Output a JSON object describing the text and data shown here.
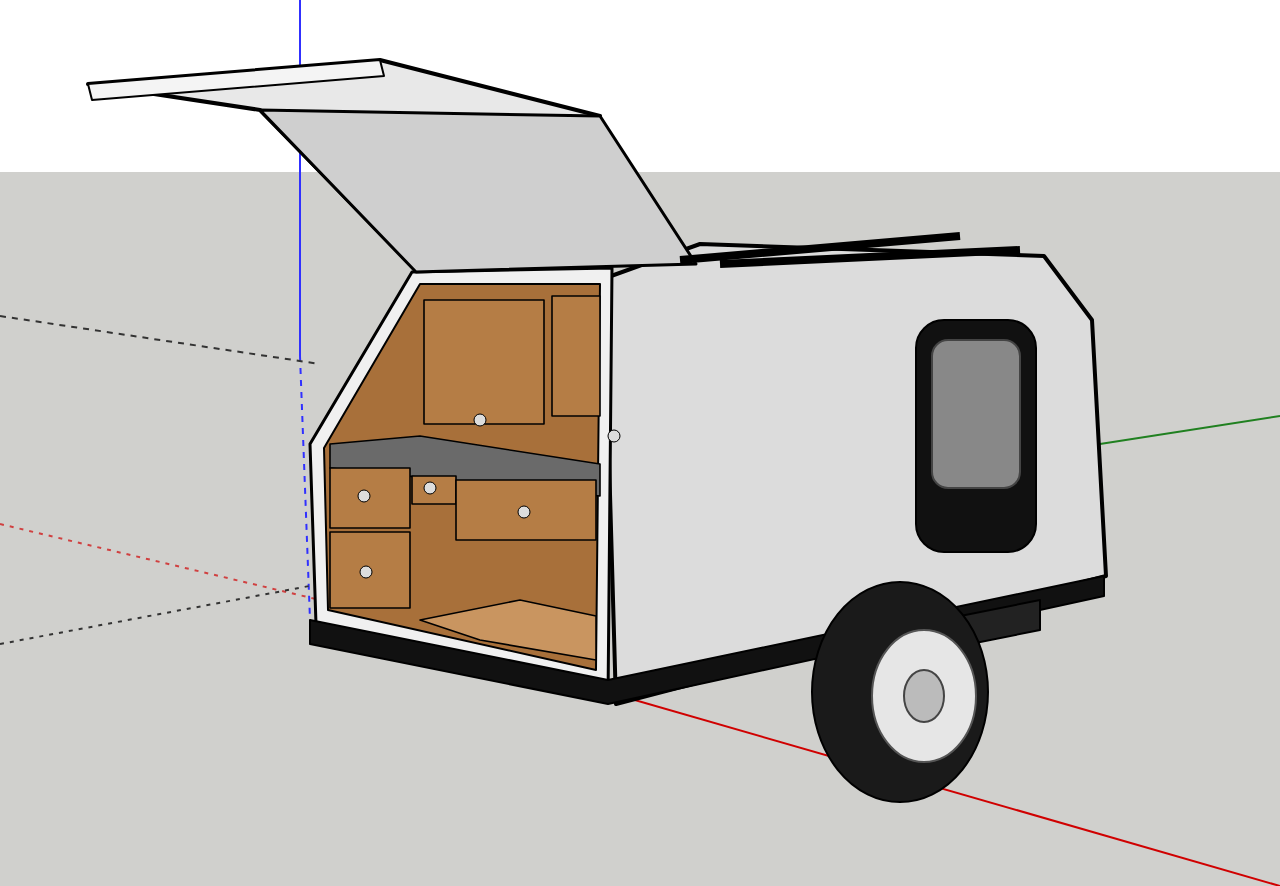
{
  "viewport": {
    "show_axes": true
  }
}
